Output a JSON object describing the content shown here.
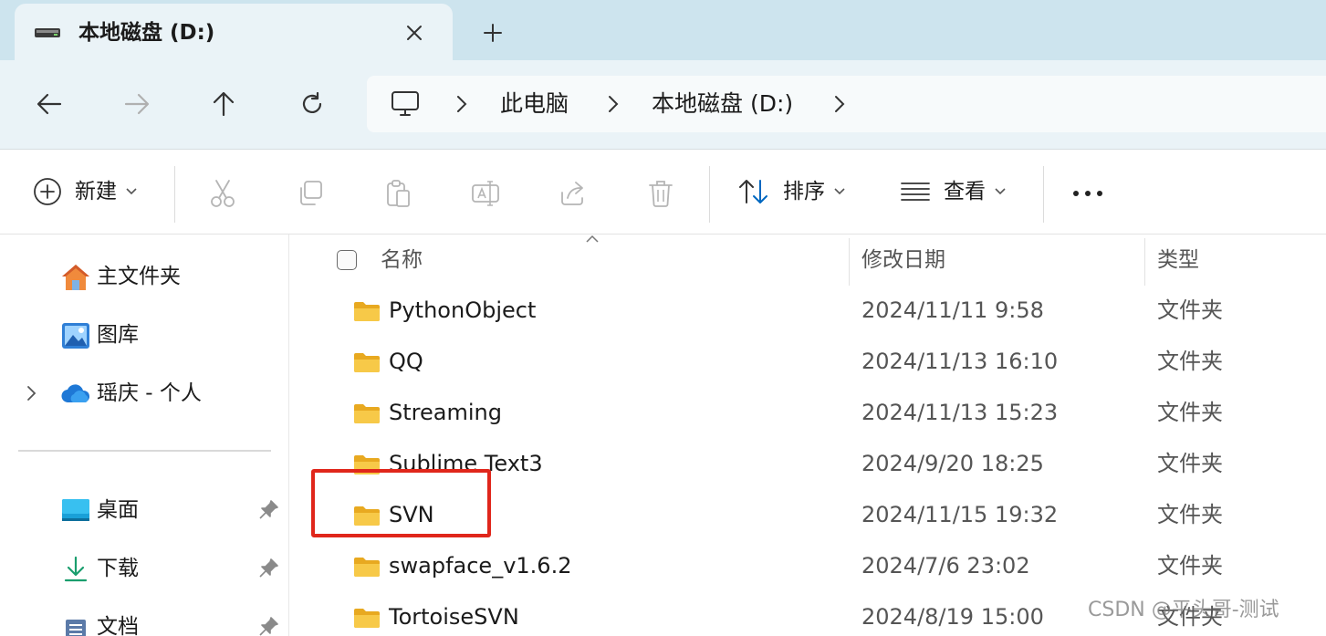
{
  "tab": {
    "title": "本地磁盘 (D:)"
  },
  "breadcrumb": [
    "此电脑",
    "本地磁盘 (D:)"
  ],
  "commands": {
    "new": "新建",
    "sort": "排序",
    "view": "查看"
  },
  "sidebar": {
    "items": [
      {
        "label": "主文件夹",
        "icon": "home-icon"
      },
      {
        "label": "图库",
        "icon": "gallery-icon"
      },
      {
        "label": "瑶庆 - 个人",
        "icon": "onedrive-cloud-icon"
      },
      {
        "label": "桌面",
        "icon": "desktop-icon",
        "pinned": true
      },
      {
        "label": "下载",
        "icon": "download-icon",
        "pinned": true
      },
      {
        "label": "文档",
        "icon": "document-icon",
        "pinned": true
      }
    ]
  },
  "columns": {
    "name": "名称",
    "modified": "修改日期",
    "type": "类型"
  },
  "files": [
    {
      "name": "PythonObject",
      "modified": "2024/11/11 9:58",
      "type": "文件夹"
    },
    {
      "name": "QQ",
      "modified": "2024/11/13 16:10",
      "type": "文件夹"
    },
    {
      "name": "Streaming",
      "modified": "2024/11/13 15:23",
      "type": "文件夹"
    },
    {
      "name": "Sublime Text3",
      "modified": "2024/9/20 18:25",
      "type": "文件夹"
    },
    {
      "name": "SVN",
      "modified": "2024/11/15 19:32",
      "type": "文件夹"
    },
    {
      "name": "swapface_v1.6.2",
      "modified": "2024/7/6 23:02",
      "type": "文件夹"
    },
    {
      "name": "TortoiseSVN",
      "modified": "2024/8/19 15:00",
      "type": "文件夹"
    }
  ],
  "watermark": "CSDN @平头哥-测试",
  "colors": {
    "accent": "#0067c0",
    "highlight": "#e0261b",
    "folder": "#f7c948"
  }
}
